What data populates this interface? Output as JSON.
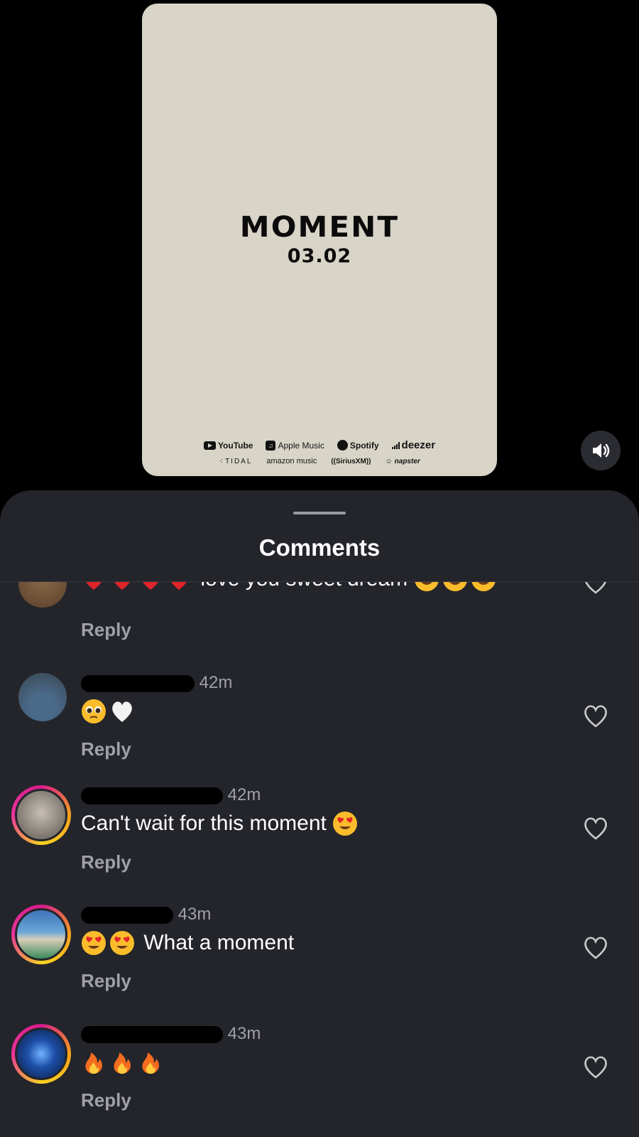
{
  "poster": {
    "title": "MOMENT",
    "date": "03.02",
    "platforms_row1": [
      "YouTube",
      "Apple Music",
      "Spotify",
      "deezer"
    ],
    "platforms_row2": [
      "TIDAL",
      "amazon music",
      "((SiriusXM))",
      "napster"
    ]
  },
  "sheet": {
    "title": "Comments"
  },
  "comments": [
    {
      "text": "love you sweet dream",
      "time": "",
      "reply": "Reply"
    },
    {
      "text": "",
      "time": "42m",
      "reply": "Reply"
    },
    {
      "text": "Can't wait for this moment",
      "time": "42m",
      "reply": "Reply"
    },
    {
      "text": "What a moment",
      "time": "43m",
      "reply": "Reply"
    },
    {
      "text": "",
      "time": "43m",
      "reply": "Reply"
    }
  ],
  "icons": {
    "sound": "speaker-icon",
    "like": "heart-outline-icon"
  },
  "colors": {
    "background": "#000000",
    "poster": "#d8d5c8",
    "sheet": "#24252b",
    "secondary_text": "#a0a1a6",
    "heart_red": "#e0242b",
    "ring_pink": "#d81b8c",
    "ring_yellow": "#f9a21b"
  }
}
